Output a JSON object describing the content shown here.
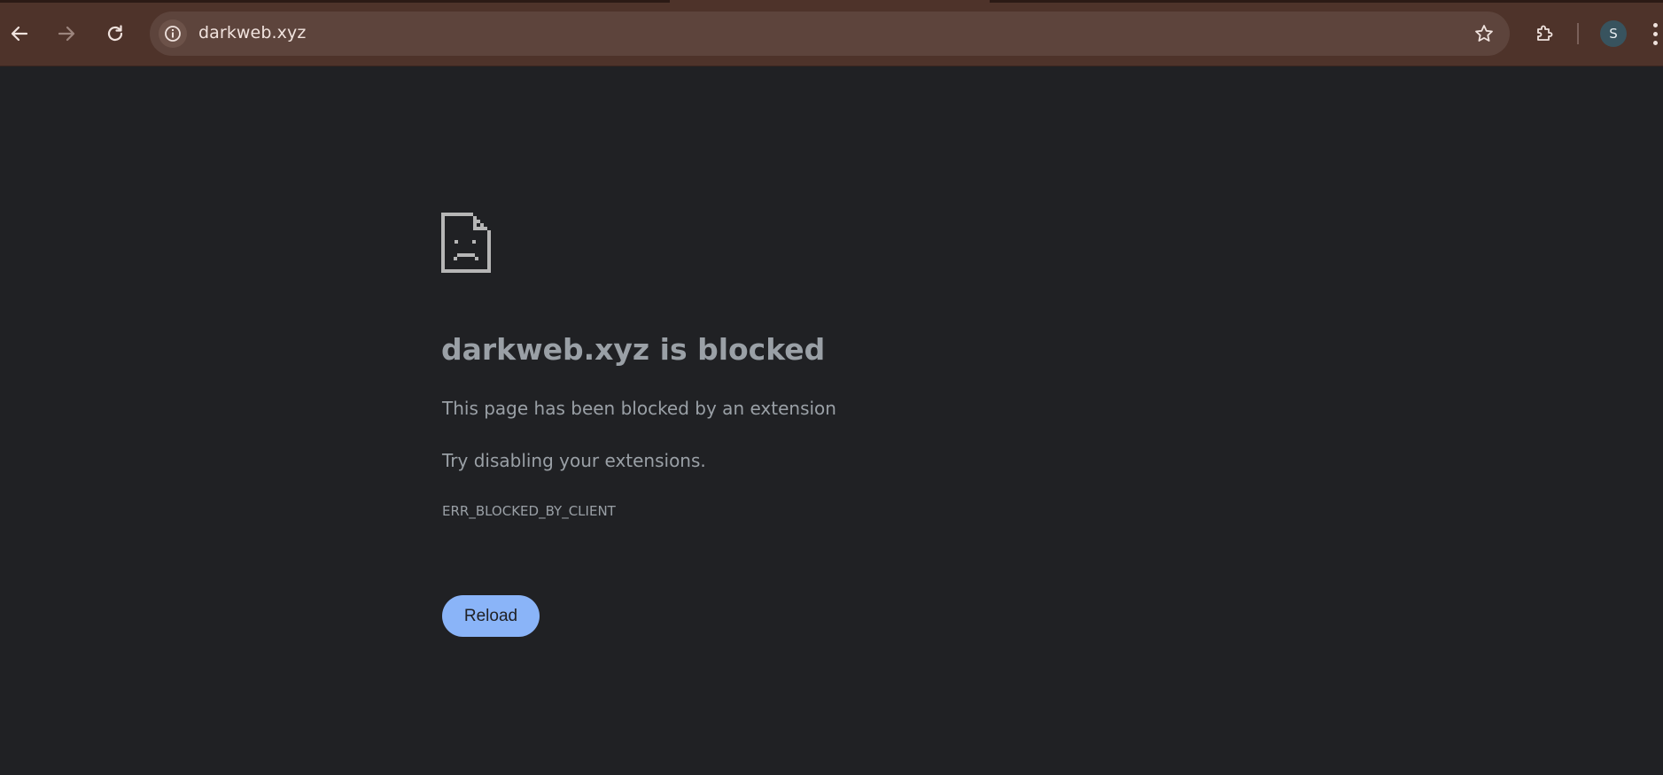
{
  "browser": {
    "url": "darkweb.xyz",
    "profile_initial": "S",
    "colors": {
      "toolbar": "#4e332a",
      "omnibox": "#5d443c",
      "avatar": "#38535e"
    },
    "icons": [
      "back-icon",
      "forward-icon",
      "reload-icon",
      "info-icon",
      "star-icon",
      "extensions-icon",
      "more-icon"
    ]
  },
  "error_page": {
    "icon": "sad-page-icon",
    "title": "darkweb.xyz is blocked",
    "message": "This page has been blocked by an extension",
    "suggestion": "Try disabling your extensions.",
    "error_code": "ERR_BLOCKED_BY_CLIENT",
    "reload_label": "Reload",
    "colors": {
      "background": "#202124",
      "text": "#9aa0a6",
      "button": "#8ab4f8"
    }
  }
}
